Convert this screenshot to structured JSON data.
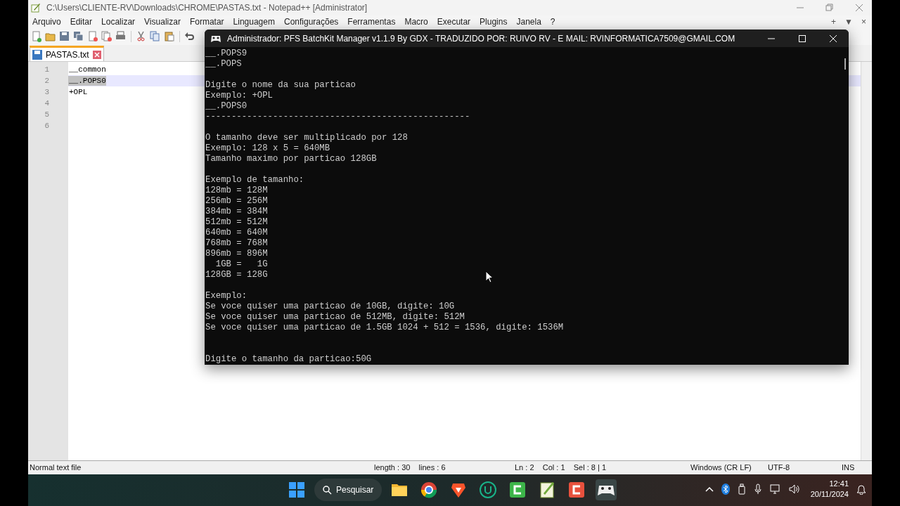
{
  "notepad": {
    "title": "C:\\Users\\CLIENTE-RV\\Downloads\\CHROME\\PASTAS.txt - Notepad++ [Administrator]",
    "menu": [
      "Arquivo",
      "Editar",
      "Localizar",
      "Visualizar",
      "Formatar",
      "Linguagem",
      "Configurações",
      "Ferramentas",
      "Macro",
      "Executar",
      "Plugins",
      "Janela",
      "?"
    ],
    "tab_controls": [
      "+",
      "▼",
      "×"
    ],
    "tabs": [
      {
        "label": "PASTAS.txt",
        "selected": true
      }
    ],
    "lines": [
      {
        "number": "1",
        "text": "__common",
        "selected": false
      },
      {
        "number": "2",
        "text": "__.POPS0",
        "selected": true
      },
      {
        "number": "3",
        "text": "+OPL",
        "selected": false
      },
      {
        "number": "4",
        "selected": false
      },
      {
        "number": "5",
        "selected": false
      },
      {
        "number": "6",
        "selected": false
      }
    ],
    "status_bar": [
      "Normal text file",
      "length : 30    lines : 6",
      "Ln : 2    Col : 1    Sel : 8 | 1",
      "Windows (CR LF)",
      "UTF-8",
      "INS"
    ]
  },
  "console": {
    "title": "Administrador:  PFS BatchKit Manager v1.1.9 By GDX - TRADUZIDO POR:  RUIVO RV - E MAIL: RVINFORMATICA7509@GMAIL.COM",
    "blocks": [
      {
        "kind": "output",
        "lines": [
          "__.POPS9",
          "__.POPS"
        ]
      },
      {
        "kind": "output",
        "lines": [
          "Digite o nome da sua particao",
          "Exemplo: +OPL",
          "__.POPS0",
          "---------------------------------------------------"
        ]
      },
      {
        "kind": "output",
        "lines": [
          "O tamanho deve ser multiplicado por 128",
          "Exemplo: 128 x 5 = 640MB",
          "Tamanho maximo por particao 128GB"
        ]
      },
      {
        "kind": "output",
        "lines": [
          "Exemplo de tamanho:",
          "128mb = 128M",
          "256mb = 256M",
          "384mb = 384M",
          "512mb = 512M",
          "640mb = 640M",
          "768mb = 768M",
          "896mb = 896M",
          "  1GB =   1G",
          "128GB = 128G"
        ]
      },
      {
        "kind": "output",
        "lines": [
          "Exemplo:",
          "Se voce quiser uma particao de 10GB, digite: 10G",
          "Se voce quiser uma particao de 512MB, digite: 512M",
          "Se voce quiser uma particao de 1.5GB 1024 + 512 = 1536, digite: 1536M"
        ]
      },
      {
        "kind": "prompt",
        "lines": [
          "Digite o tamanho da particao:50G"
        ]
      }
    ]
  },
  "taskbar": {
    "search": "Pesquisar",
    "time": "12:41",
    "date": "20/11/2024"
  }
}
